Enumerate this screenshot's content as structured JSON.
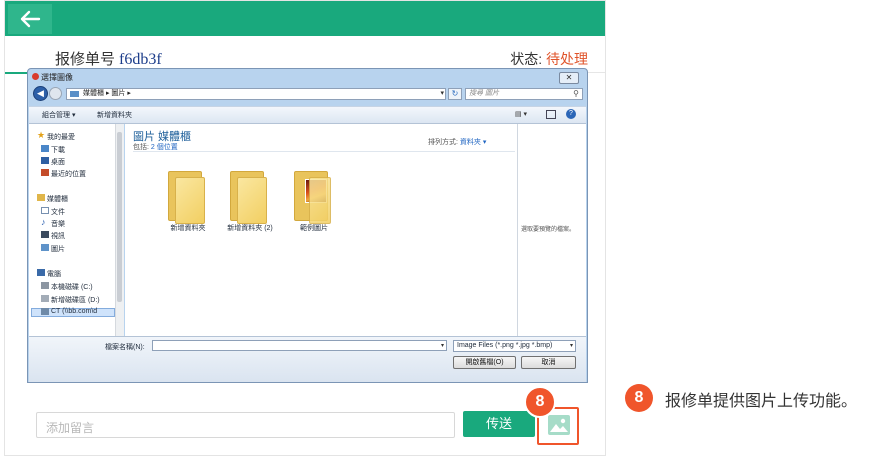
{
  "header": {
    "order_label": "报修单号",
    "order_number": "f6db3f",
    "status_label": "状态:",
    "status_value": "待处理"
  },
  "colors": {
    "brand": "#19a97d",
    "accent": "#f0552b",
    "status": "#e0542b"
  },
  "dialog": {
    "title": "選擇圖像",
    "close_label": "✕",
    "address_path": "媒體櫃 ▸ 圖片 ▸",
    "search_placeholder": "搜尋 圖片",
    "toolbar": {
      "organize": "組合管理 ▾",
      "new_folder": "新增資料夾",
      "view_icon": "▤ ▾"
    },
    "nav": {
      "favorites": "我的最愛",
      "downloads": "下載",
      "desktop": "桌面",
      "recent": "最近的位置",
      "libraries": "媒體櫃",
      "documents": "文件",
      "music": "音樂",
      "videos": "視訊",
      "pictures": "圖片",
      "computer": "電腦",
      "disk_c": "本機磁碟 (C:)",
      "disk_d": "新增磁碟區 (D:)",
      "network": "CT (\\\\bb.com\\d"
    },
    "library_title": "圖片 媒體櫃",
    "library_includes": "包括: ",
    "library_locations": "2 個位置",
    "sort_label": "排列方式:",
    "sort_value": "資料夾 ▾",
    "folders": [
      {
        "label": "新增資料夾"
      },
      {
        "label": "新增資料夾 (2)"
      },
      {
        "label": "範例圖片"
      }
    ],
    "preview_hint": "選取要預覽的檔案。",
    "filename_label": "檔案名稱(N):",
    "filetype_value": "Image Files (*.png *.jpg *.bmp)",
    "open_button": "開啟舊檔(O)",
    "cancel_button": "取消"
  },
  "footer": {
    "comment_placeholder": "添加留言",
    "send_button": "传送",
    "badge": "8"
  },
  "annotation": {
    "badge": "8",
    "caption": "报修单提供图片上传功能。"
  }
}
